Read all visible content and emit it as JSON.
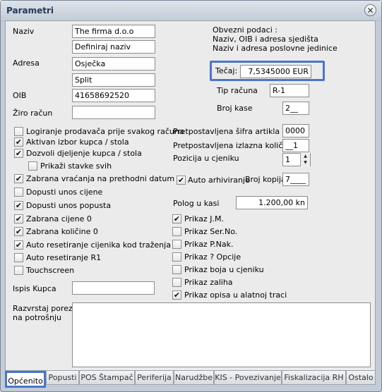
{
  "window": {
    "title": "Parametri",
    "close_glyph": "✕"
  },
  "left": {
    "naziv_label": "Naziv",
    "naziv_value": "The firma d.o.o",
    "definiraj_value": "Definiraj naziv",
    "adresa_label": "Adresa",
    "adresa_value": "Osječka",
    "grad_value": "Split",
    "oib_label": "OIB",
    "oib_value": "41658692520",
    "ziro_label": "Žiro račun",
    "ziro_value": ""
  },
  "right_info": {
    "obvezni_title": "Obvezni podaci :",
    "line1": "Naziv, OIB i adresa sjedišta",
    "line2": "Naziv i adresa poslovne jedinice",
    "tecaj_label": "Tečaj:",
    "tecaj_value": "7,5345000 EUR",
    "tip_label": "Tip računa",
    "tip_value": "R-1",
    "broj_kase_label": "Broj kase",
    "broj_kase_value": "2__"
  },
  "checks": [
    {
      "label": "Logiranje prodavača prije svakog računa",
      "checked": false
    },
    {
      "label": "Aktivan izbor kupca / stola",
      "checked": true
    },
    {
      "label": "Dozvoli djeljenje kupca / stola",
      "checked": true
    },
    {
      "label": "Prikaži stavke svih",
      "checked": false
    },
    {
      "label": "Zabrana vraćanja na prethodni datum",
      "checked": true
    },
    {
      "label": "Dopusti unos cijene",
      "checked": false
    },
    {
      "label": "Dopusti unos popusta",
      "checked": true
    },
    {
      "label": "Zabrana cijene  0",
      "checked": true
    },
    {
      "label": "Zabrana količine 0",
      "checked": true
    },
    {
      "label": "Auto resetiranje cijenika kod traženja",
      "checked": true
    },
    {
      "label": "Auto resetiranje R1",
      "checked": false
    },
    {
      "label": "Touchscreen",
      "checked": false
    }
  ],
  "ispis_label": "Ispis Kupca",
  "ispis_value": "",
  "razvrstaj_label_1": "Razvrstaj porez",
  "razvrstaj_label_2": "na potrošnju",
  "middle": {
    "sifra_label": "Pretpostavljena šifra artikla",
    "sifra_value": "0000",
    "kolicina_label": "Pretpostavljena izlazna količina",
    "kolicina_value": "__1",
    "pozicija_label": "Pozicija u cjeniku",
    "pozicija_value": "1",
    "auto_arh_label": "Auto arhiviranje",
    "auto_arh_checked": true,
    "broj_kopija_label": "Broj kopija",
    "broj_kopija_value": "7____",
    "polog_label": "Polog u kasi",
    "polog_value": "1.200,00 kn"
  },
  "prikaz": [
    {
      "label": "Prikaz J.M.",
      "checked": true
    },
    {
      "label": "Prikaz Ser.No.",
      "checked": false
    },
    {
      "label": "Prikaz P.Nak.",
      "checked": false
    },
    {
      "label": "Prikaz ? Opcije",
      "checked": false
    },
    {
      "label": "Prikaz boja u cjeniku",
      "checked": false
    },
    {
      "label": "Prikaz zaliha",
      "checked": false
    },
    {
      "label": "Prikaz opisa u alatnoj traci",
      "checked": true
    }
  ],
  "tabs": [
    "Općenito",
    "Popusti",
    "POS Štampač",
    "Periferija",
    "Narudžbe",
    "KIS - Povezivanje",
    "Fiskalizacija RH",
    "Ostalo"
  ],
  "check_glyph": "✔"
}
